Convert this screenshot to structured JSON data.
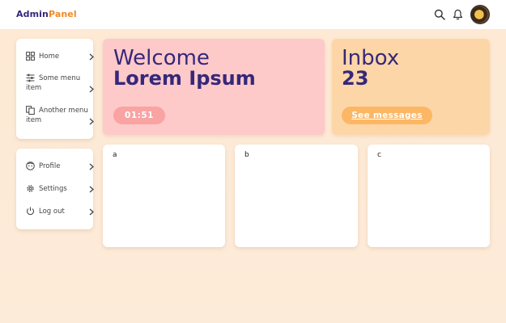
{
  "header": {
    "logo_part1": "Admin",
    "logo_part2": "Panel",
    "icons": [
      "search-icon",
      "bell-icon",
      "avatar"
    ]
  },
  "sidebar": {
    "primary": [
      {
        "label": "Home",
        "icon": "grid-icon"
      },
      {
        "label": "Some menu item",
        "icon": "sliders-icon"
      },
      {
        "label": "Another menu item",
        "icon": "copy-icon"
      }
    ],
    "secondary": [
      {
        "label": "Profile",
        "icon": "face-icon"
      },
      {
        "label": "Settings",
        "icon": "gear-icon"
      },
      {
        "label": "Log out",
        "icon": "power-icon"
      }
    ]
  },
  "welcome": {
    "greeting": "Welcome",
    "name": "Lorem Ipsum",
    "timer": "01:51"
  },
  "inbox": {
    "title": "Inbox",
    "count": "23",
    "button": "See messages"
  },
  "cards": [
    {
      "label": "a"
    },
    {
      "label": "b"
    },
    {
      "label": "c"
    }
  ],
  "colors": {
    "brand_dark": "#35287a",
    "brand_accent": "#f08a24",
    "welcome_bg": "#fec9c9",
    "inbox_bg": "#fdd6a8"
  }
}
